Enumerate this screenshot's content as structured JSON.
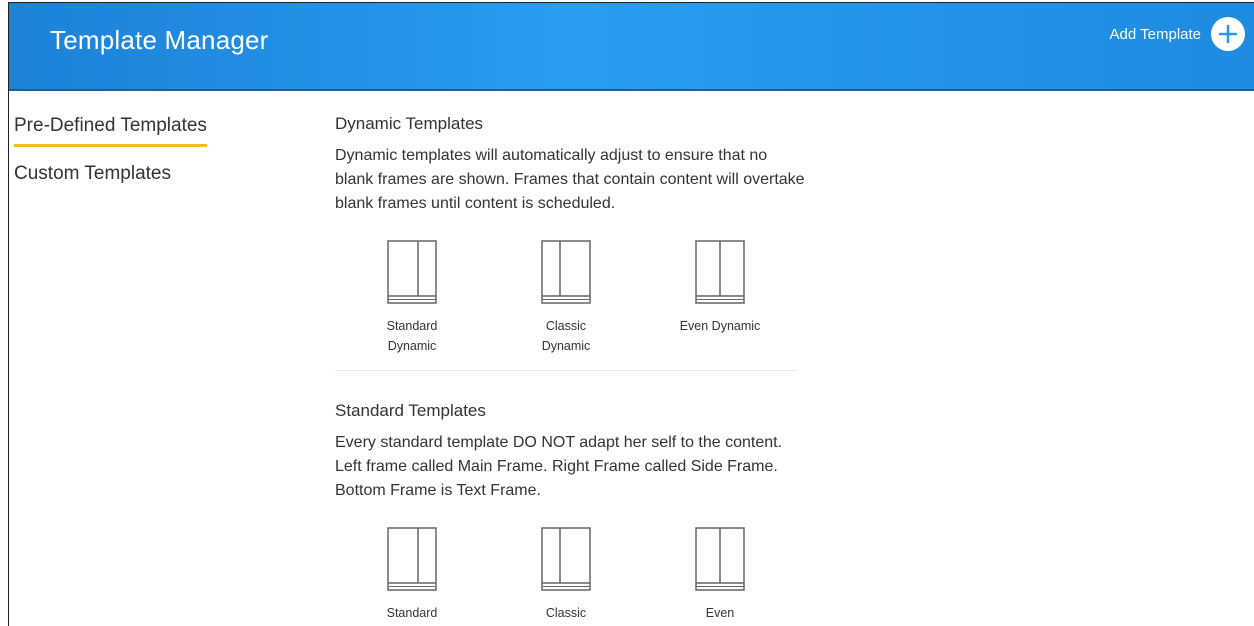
{
  "header": {
    "title": "Template Manager",
    "add_label": "Add Template",
    "add_icon": "plus-icon",
    "gradient_colors": [
      "#1b82d8",
      "#2a9cf0"
    ]
  },
  "sidebar": {
    "items": [
      {
        "label": "Pre-Defined Templates",
        "active": true
      },
      {
        "label": "Custom Templates",
        "active": false
      }
    ],
    "active_indicator_color": "#f2c012"
  },
  "sections": [
    {
      "title": "Dynamic Templates",
      "description": "Dynamic templates will automatically adjust to ensure that no blank frames are shown. Frames that contain content will overtake blank frames until content is scheduled.",
      "tiles": [
        {
          "label": "Standard Dynamic",
          "icon": "standard-layout-icon"
        },
        {
          "label": "Classic Dynamic",
          "icon": "classic-layout-icon"
        },
        {
          "label": "Even Dynamic",
          "icon": "even-layout-icon"
        }
      ]
    },
    {
      "title": "Standard Templates",
      "description": "Every standard template DO NOT adapt her self to the content. Left frame called Main Frame. Right Frame called Side Frame. Bottom Frame is Text Frame.",
      "tiles": [
        {
          "label": "Standard",
          "icon": "standard-layout-icon"
        },
        {
          "label": "Classic",
          "icon": "classic-layout-icon"
        },
        {
          "label": "Even",
          "icon": "even-layout-icon"
        }
      ]
    }
  ]
}
